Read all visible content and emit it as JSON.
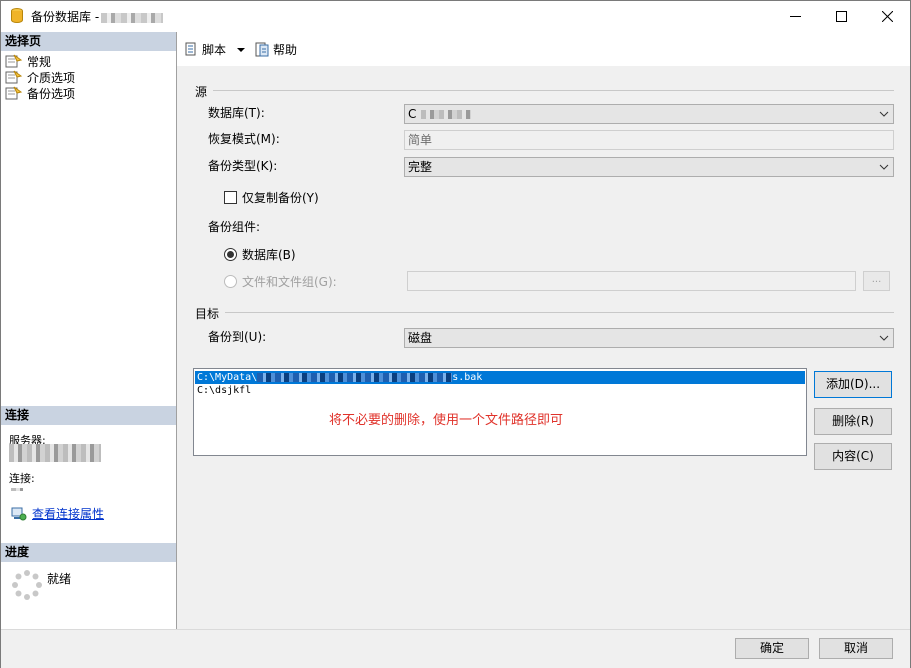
{
  "window": {
    "title": "备份数据库 -",
    "controls": [
      "minimize-icon",
      "maximize-icon",
      "close-icon"
    ]
  },
  "left_panel": {
    "select_page_header": "选择页",
    "pages": [
      {
        "label": "常规",
        "icon": "page-icon"
      },
      {
        "label": "介质选项",
        "icon": "page-icon"
      },
      {
        "label": "备份选项",
        "icon": "page-icon"
      }
    ],
    "connection_header": "连接",
    "server_label": "服务器:",
    "connection_label": "连接:",
    "view_connection_link": "查看连接属性",
    "progress_header": "进度",
    "progress_status": "就绪"
  },
  "toolbar": {
    "script_label": "脚本",
    "help_label": "帮助"
  },
  "source": {
    "group_label": "源",
    "database_label": "数据库(T):",
    "database_value": "C",
    "recovery_label": "恢复模式(M):",
    "recovery_value": "简单",
    "backup_type_label": "备份类型(K):",
    "backup_type_value": "完整",
    "copy_only_label": "仅复制备份(Y)",
    "copy_only_checked": false,
    "component_label": "备份组件:",
    "component_database": "数据库(B)",
    "component_files": "文件和文件组(G):",
    "browse_label": "...",
    "selected_component": "数据库(B)"
  },
  "destination": {
    "group_label": "目标",
    "backup_to_label": "备份到(U):",
    "backup_to_value": "磁盘",
    "paths": [
      {
        "prefix": "C:\\MyData\\",
        "suffix": "s.bak",
        "selected": true
      },
      {
        "prefix": "C:\\dsjkfl",
        "suffix": "",
        "selected": false
      }
    ],
    "annotation": "将不必要的删除，使用一个文件路径即可",
    "add_button": "添加(D)...",
    "remove_button": "删除(R)",
    "contents_button": "内容(C)"
  },
  "footer": {
    "ok_button": "确定",
    "cancel_button": "取消"
  },
  "colors": {
    "section_header": "#c9d3e1",
    "selection": "#0078d7",
    "annotation": "#e0322a",
    "link": "#0033cc"
  }
}
